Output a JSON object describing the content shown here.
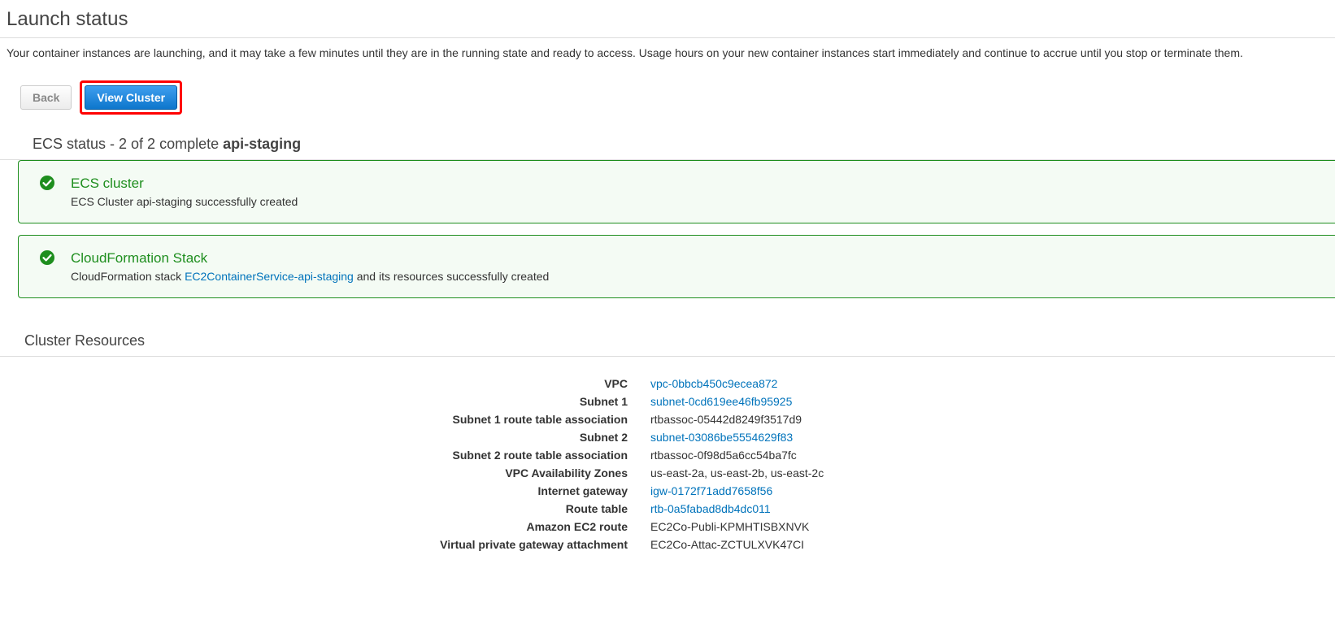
{
  "page": {
    "title": "Launch status",
    "description": "Your container instances are launching, and it may take a few minutes until they are in the running state and ready to access. Usage hours on your new container instances start immediately and continue to accrue until you stop or terminate them."
  },
  "buttons": {
    "back": "Back",
    "view_cluster": "View Cluster"
  },
  "ecs_status": {
    "header_prefix": "ECS status - 2 of 2 complete ",
    "cluster_name": "api-staging",
    "items": [
      {
        "title": "ECS cluster",
        "desc_pre": "ECS Cluster api-staging successfully created",
        "link_text": "",
        "desc_post": ""
      },
      {
        "title": "CloudFormation Stack",
        "desc_pre": "CloudFormation stack ",
        "link_text": "EC2ContainerService-api-staging",
        "desc_post": " and its resources successfully created"
      }
    ]
  },
  "resources": {
    "header": "Cluster Resources",
    "rows": [
      {
        "label": "VPC",
        "value": "vpc-0bbcb450c9ecea872",
        "link": true
      },
      {
        "label": "Subnet 1",
        "value": "subnet-0cd619ee46fb95925",
        "link": true
      },
      {
        "label": "Subnet 1 route table association",
        "value": "rtbassoc-05442d8249f3517d9",
        "link": false
      },
      {
        "label": "Subnet 2",
        "value": "subnet-03086be5554629f83",
        "link": true
      },
      {
        "label": "Subnet 2 route table association",
        "value": "rtbassoc-0f98d5a6cc54ba7fc",
        "link": false
      },
      {
        "label": "VPC Availability Zones",
        "value": "us-east-2a, us-east-2b, us-east-2c",
        "link": false
      },
      {
        "label": "Internet gateway",
        "value": "igw-0172f71add7658f56",
        "link": true
      },
      {
        "label": "Route table",
        "value": "rtb-0a5fabad8db4dc011",
        "link": true
      },
      {
        "label": "Amazon EC2 route",
        "value": "EC2Co-Publi-KPMHTISBXNVK",
        "link": false
      },
      {
        "label": "Virtual private gateway attachment",
        "value": "EC2Co-Attac-ZCTULXVK47CI",
        "link": false
      }
    ]
  }
}
